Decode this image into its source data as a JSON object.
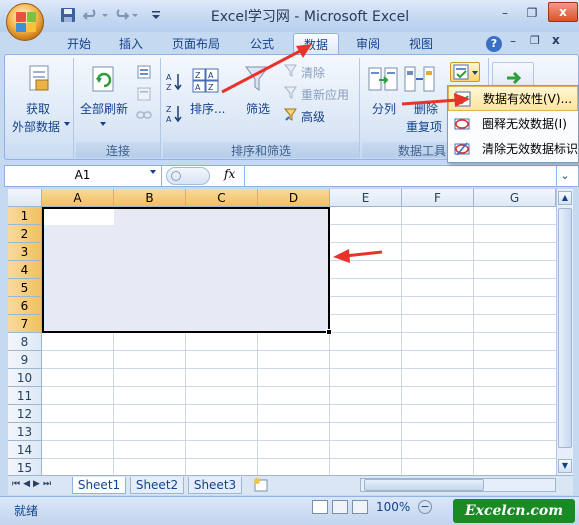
{
  "window": {
    "title": "Excel学习网 - Microsoft Excel",
    "minimize_glyph": "–",
    "restore_glyph": "❐",
    "close_glyph": "x",
    "help_glyph": "?"
  },
  "tabs": [
    {
      "label": "开始"
    },
    {
      "label": "插入"
    },
    {
      "label": "页面布局"
    },
    {
      "label": "公式"
    },
    {
      "label": "数据",
      "active": true
    },
    {
      "label": "审阅"
    },
    {
      "label": "视图"
    }
  ],
  "ribbon": {
    "external_data": {
      "line1": "获取",
      "line2": "外部数据"
    },
    "connections": {
      "refresh_line1": "全部刷新",
      "group": "连接"
    },
    "sort_filter": {
      "sort": "排序...",
      "filter": "筛选",
      "clear": "清除",
      "reapply": "重新应用",
      "advanced": "高级",
      "group": "排序和筛选"
    },
    "data_tools": {
      "text_to_columns": "分列",
      "remove_dup_line1": "删除",
      "remove_dup_line2": "重复项",
      "group": "数据工具"
    }
  },
  "dropdown_menu": {
    "items": [
      {
        "label": "数据有效性(V)...",
        "highlighted": true
      },
      {
        "label": "圈释无效数据(I)"
      },
      {
        "label": "清除无效数据标识"
      }
    ]
  },
  "formula_bar": {
    "name_box": "A1",
    "fx": "fx",
    "value": ""
  },
  "grid": {
    "columns": [
      "A",
      "B",
      "C",
      "D",
      "E",
      "F",
      "G"
    ],
    "selected_columns": [
      "A",
      "B",
      "C",
      "D"
    ],
    "rows": [
      "1",
      "2",
      "3",
      "4",
      "5",
      "6",
      "7",
      "8",
      "9",
      "10",
      "11",
      "12",
      "13",
      "14",
      "15"
    ],
    "selected_rows": [
      "1",
      "2",
      "3",
      "4",
      "5",
      "6",
      "7"
    ],
    "selection_range": "A1:D7"
  },
  "sheets": {
    "tabs": [
      "Sheet1",
      "Sheet2",
      "Sheet3"
    ],
    "active": "Sheet1"
  },
  "status_bar": {
    "status": "就绪",
    "zoom": "100%"
  },
  "watermark": {
    "text": "Excelcn.com"
  },
  "colors": {
    "arrow": "#e8332a",
    "selection_fill": "#e7eaf5",
    "header_selected": "#f5cc72"
  }
}
